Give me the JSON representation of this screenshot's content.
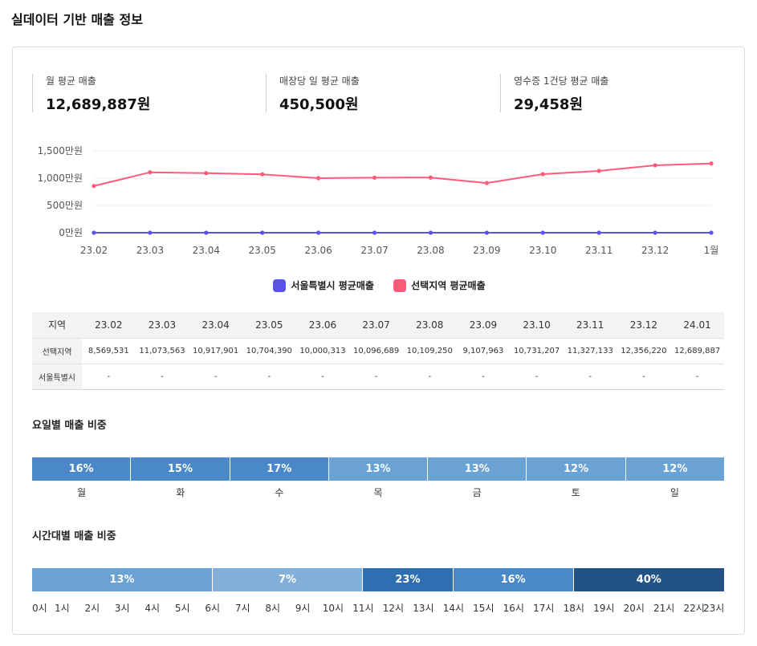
{
  "page_title": "실데이터 기반 매출 정보",
  "kpis": [
    {
      "label": "월 평균 매출",
      "value": "12,689,887원"
    },
    {
      "label": "매장당 일 평균 매출",
      "value": "450,500원"
    },
    {
      "label": "영수증 1건당 평균 매출",
      "value": "29,458원"
    }
  ],
  "legend": [
    {
      "label": "서울특별시 평균매출",
      "color": "#5b52e6"
    },
    {
      "label": "선택지역 평균매출",
      "color": "#ff5a7a"
    }
  ],
  "chart_data": {
    "type": "line",
    "categories": [
      "23.02",
      "23.03",
      "23.04",
      "23.05",
      "23.06",
      "23.07",
      "23.08",
      "23.09",
      "23.10",
      "23.11",
      "23.12",
      "1월"
    ],
    "y_tick_labels": [
      "1,500만원",
      "1,000만원",
      "500만원",
      "0만원"
    ],
    "y_tick_values": [
      15000000,
      10000000,
      5000000,
      0
    ],
    "ylim": [
      0,
      15000000
    ],
    "grid": true,
    "legend_position": "bottom",
    "series": [
      {
        "name": "서울특별시 평균매출",
        "color": "#5b52e6",
        "values": [
          0,
          0,
          0,
          0,
          0,
          0,
          0,
          0,
          0,
          0,
          0,
          0
        ]
      },
      {
        "name": "선택지역 평균매출",
        "color": "#ff5a7a",
        "values": [
          8569531,
          11073563,
          10917901,
          10704390,
          10000313,
          10096689,
          10109250,
          9107963,
          10731207,
          11327133,
          12356220,
          12689887
        ]
      }
    ]
  },
  "table": {
    "headers": [
      "지역",
      "23.02",
      "23.03",
      "23.04",
      "23.05",
      "23.06",
      "23.07",
      "23.08",
      "23.09",
      "23.10",
      "23.11",
      "23.12",
      "24.01"
    ],
    "rows": [
      {
        "label": "선택지역",
        "cells": [
          "8,569,531",
          "11,073,563",
          "10,917,901",
          "10,704,390",
          "10,000,313",
          "10,096,689",
          "10,109,250",
          "9,107,963",
          "10,731,207",
          "11,327,133",
          "12,356,220",
          "12,689,887"
        ]
      },
      {
        "label": "서울특별시",
        "cells": [
          "-",
          "-",
          "-",
          "-",
          "-",
          "-",
          "-",
          "-",
          "-",
          "-",
          "-",
          "-"
        ]
      }
    ]
  },
  "weekday": {
    "title": "요일별 매출 비중",
    "segments": [
      {
        "label": "월",
        "pct": "16%",
        "color": "#4a88c7"
      },
      {
        "label": "화",
        "pct": "15%",
        "color": "#4a88c7"
      },
      {
        "label": "수",
        "pct": "17%",
        "color": "#4a88c7"
      },
      {
        "label": "목",
        "pct": "13%",
        "color": "#6aa2d3"
      },
      {
        "label": "금",
        "pct": "13%",
        "color": "#6aa2d3"
      },
      {
        "label": "토",
        "pct": "12%",
        "color": "#6aa2d3"
      },
      {
        "label": "일",
        "pct": "12%",
        "color": "#6aa2d3"
      }
    ]
  },
  "hourly": {
    "title": "시간대별 매출 비중",
    "segments": [
      {
        "pct": "13%",
        "value": 13,
        "hours": 6,
        "color": "#6aa2d3"
      },
      {
        "pct": "7%",
        "value": 7,
        "hours": 5,
        "color": "#84afd9"
      },
      {
        "pct": "23%",
        "value": 23,
        "hours": 3,
        "color": "#2d6fb0"
      },
      {
        "pct": "16%",
        "value": 16,
        "hours": 4,
        "color": "#4a88c7"
      },
      {
        "pct": "40%",
        "value": 40,
        "hours": 5,
        "color": "#235284"
      }
    ],
    "hour_labels": [
      "0시",
      "1시",
      "2시",
      "3시",
      "4시",
      "5시",
      "6시",
      "7시",
      "8시",
      "9시",
      "10시",
      "11시",
      "12시",
      "13시",
      "14시",
      "15시",
      "16시",
      "17시",
      "18시",
      "19시",
      "20시",
      "21시",
      "22시",
      "23시"
    ]
  }
}
